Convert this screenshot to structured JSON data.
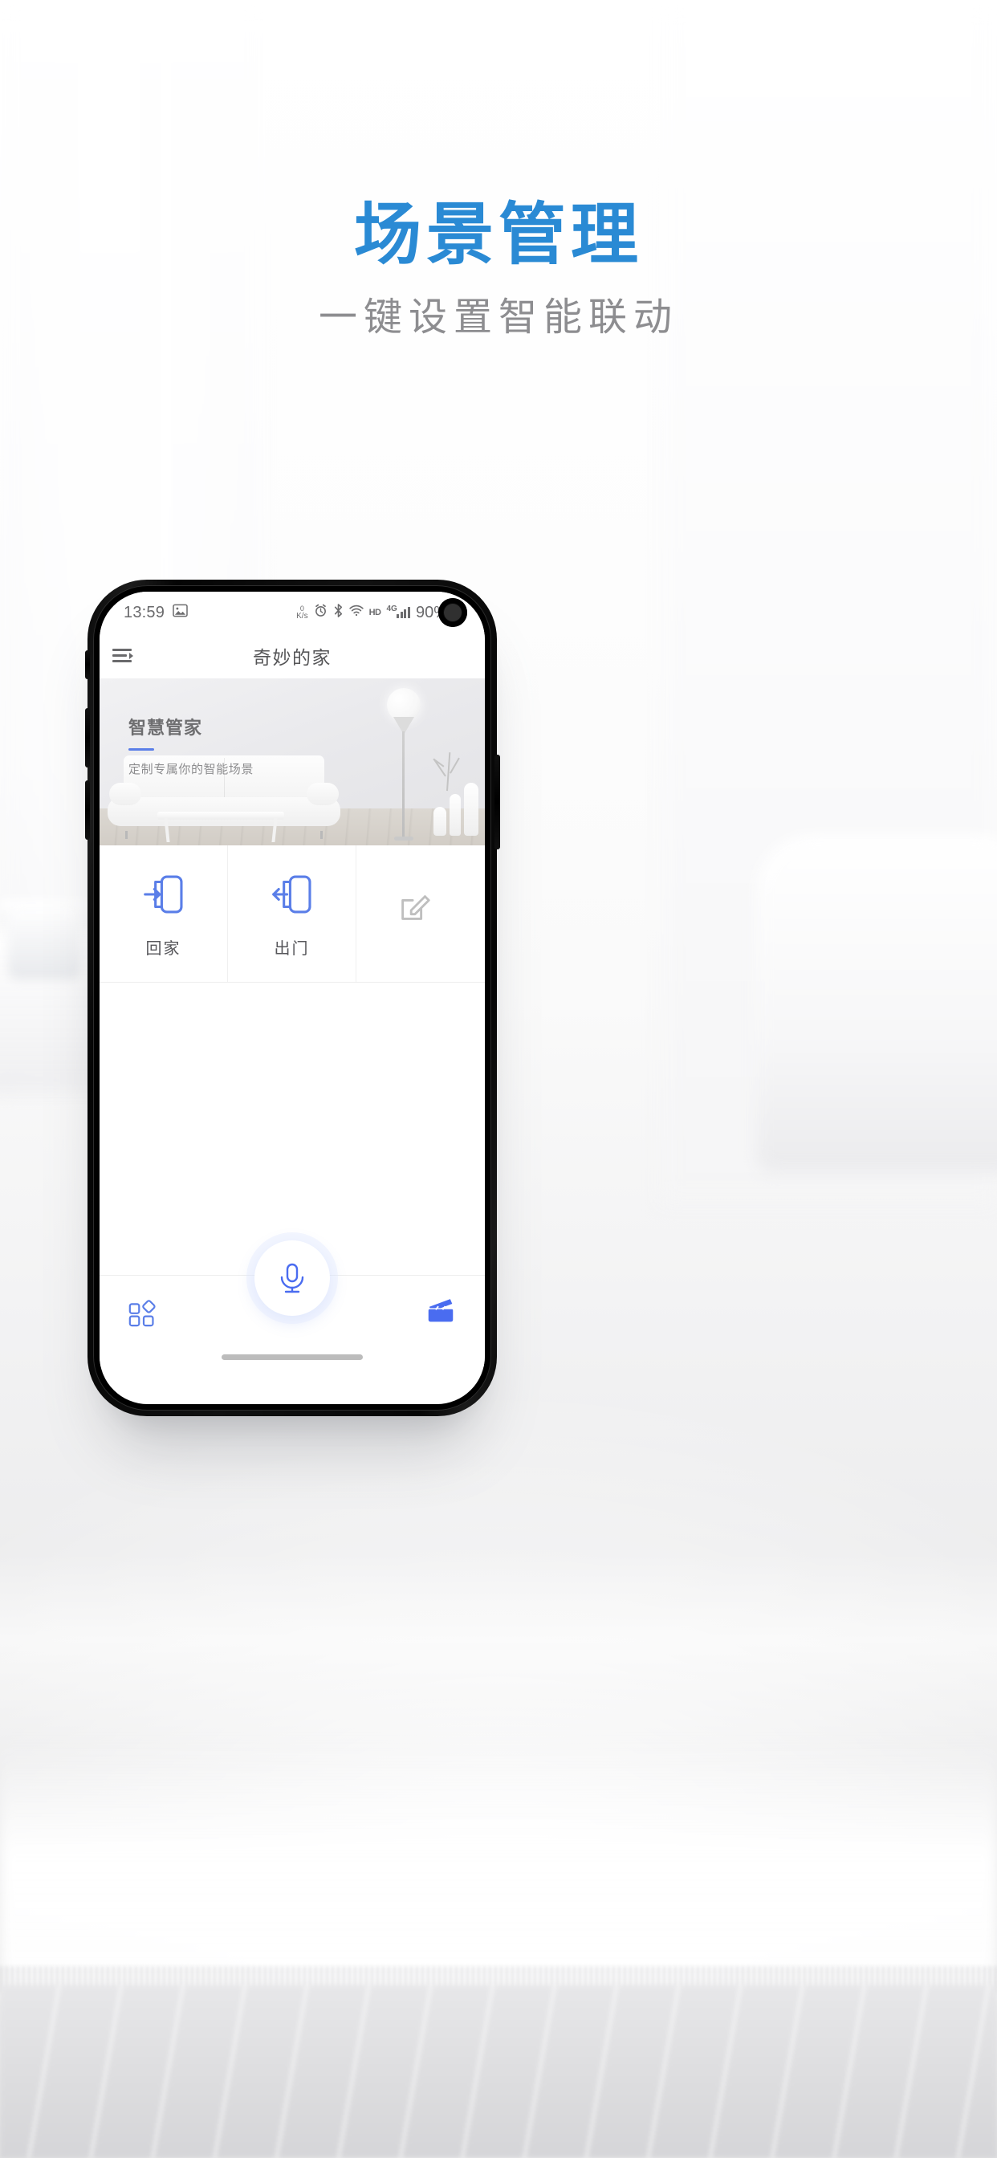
{
  "promo": {
    "title": "场景管理",
    "subtitle": "一键设置智能联动",
    "title_color": "#2a8ad4",
    "subtitle_color": "#8d8d90"
  },
  "phone": {
    "status_bar": {
      "time": "13:59",
      "gallery_icon": "image-icon",
      "net_speed_value": "0",
      "net_speed_unit": "K/s",
      "alarm_icon": "alarm-icon",
      "bluetooth_icon": "bluetooth-icon",
      "wifi_icon": "wifi-icon",
      "hd_label": "HD",
      "network_label": "4G",
      "battery_percent": "90%",
      "battery_icon": "battery-icon",
      "camera_icon": "front-camera-icon"
    },
    "app_header": {
      "menu_icon": "menu-icon",
      "title": "奇妙的家"
    },
    "banner": {
      "heading": "智慧管家",
      "subtext": "定制专属你的智能场景",
      "rule_color": "#5a7ee8"
    },
    "scenes": [
      {
        "label": "回家",
        "icon": "door-enter-icon",
        "color": "#5a7ee8"
      },
      {
        "label": "出门",
        "icon": "door-exit-icon",
        "color": "#5a7ee8"
      },
      {
        "label": "",
        "icon": "edit-square-icon",
        "color": "#bfbfbf"
      }
    ],
    "bottom_nav": {
      "grid_icon": "grid-apps-icon",
      "mic_icon": "microphone-icon",
      "scene_icon": "clapperboard-icon",
      "accent_color": "#4a6cf0",
      "home_indicator": "home-indicator"
    }
  }
}
